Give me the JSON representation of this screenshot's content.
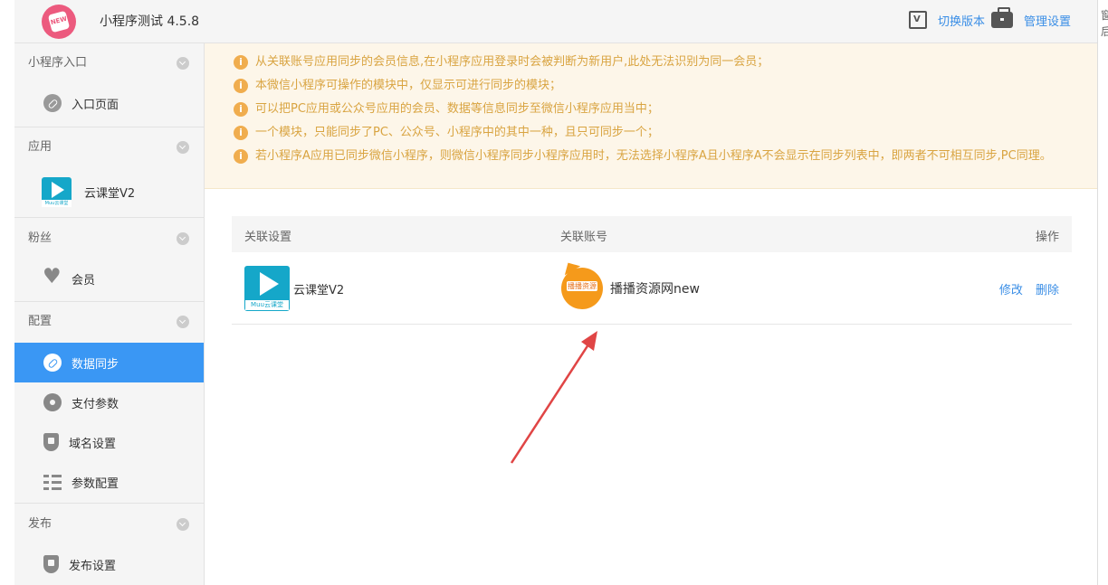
{
  "header": {
    "title": "小程序测试 4.5.8",
    "logo_text": "NEW",
    "switch_version": "切换版本",
    "manage_settings": "管理设置"
  },
  "edge_text": "窗 后",
  "sidebar": {
    "groups": [
      {
        "title": "小程序入口",
        "items": [
          {
            "label": "入口页面",
            "icon": "link-icon"
          }
        ]
      },
      {
        "title": "应用",
        "items": [
          {
            "label": "云课堂V2",
            "icon": "muu-app-icon"
          }
        ]
      },
      {
        "title": "粉丝",
        "items": [
          {
            "label": "会员",
            "icon": "heart-icon"
          }
        ]
      },
      {
        "title": "配置",
        "items": [
          {
            "label": "数据同步",
            "icon": "link-icon",
            "active": true
          },
          {
            "label": "支付参数",
            "icon": "gear-icon"
          },
          {
            "label": "域名设置",
            "icon": "shield-icon"
          },
          {
            "label": "参数配置",
            "icon": "list-icon"
          }
        ]
      },
      {
        "title": "发布",
        "items": [
          {
            "label": "发布设置",
            "icon": "shield-icon"
          }
        ]
      }
    ]
  },
  "notice": {
    "lines": [
      "从关联账号应用同步的会员信息,在小程序应用登录时会被判断为新用户,此处无法识别为同一会员；",
      "本微信小程序可操作的模块中，仅显示可进行同步的模块；",
      "可以把PC应用或公众号应用的会员、数据等信息同步至微信小程序应用当中；",
      "一个模块，只能同步了PC、公众号、小程序中的其中一种，且只可同步一个；",
      "若小程序A应用已同步微信小程序，则微信小程序同步小程序应用时，无法选择小程序A且小程序A不会显示在同步列表中，即两者不可相互同步,PC同理。"
    ]
  },
  "table": {
    "columns": {
      "setting": "关联设置",
      "account": "关联账号",
      "action": "操作"
    },
    "rows": [
      {
        "app": "云课堂V2",
        "account": "播播资源网new",
        "account_badge": "播播资源",
        "edit": "修改",
        "delete": "删除"
      }
    ]
  },
  "colors": {
    "accent": "#3a97f4",
    "link": "#3a8ee6",
    "notice_text": "#d9a441",
    "annotation_arrow": "#e04545"
  }
}
